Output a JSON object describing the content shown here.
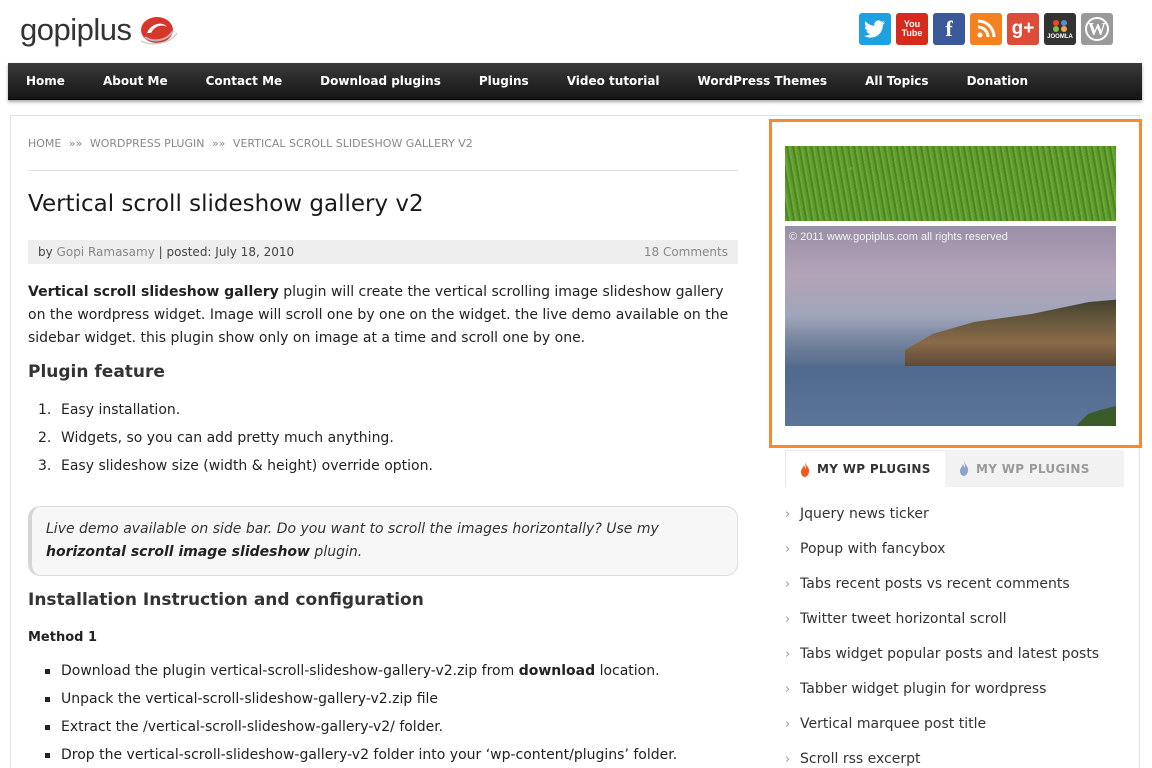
{
  "header": {
    "logo_text": "gopiplus",
    "social_icons": [
      "twitter-icon",
      "youtube-icon",
      "facebook-icon",
      "rss-icon",
      "google-plus-icon",
      "joomla-icon",
      "wordpress-icon"
    ],
    "social_labels": {
      "youtube": "You Tube",
      "facebook": "f",
      "google": "g+",
      "joomla": "JOOMLA",
      "wordpress": "W"
    }
  },
  "nav": {
    "items": [
      "Home",
      "About Me",
      "Contact Me",
      "Download plugins",
      "Plugins",
      "Video tutorial",
      "WordPress Themes",
      "All Topics",
      "Donation"
    ]
  },
  "breadcrumb": {
    "items": [
      "HOME",
      "WORDPRESS PLUGIN",
      "VERTICAL SCROLL SLIDESHOW GALLERY V2"
    ],
    "separator": "»»"
  },
  "post": {
    "title": "Vertical scroll slideshow gallery v2",
    "meta_by": "by",
    "author": "Gopi Ramasamy",
    "posted": "| posted: July 18, 2010",
    "comments": "18 Comments",
    "intro_bold": "Vertical scroll slideshow gallery",
    "intro_rest": " plugin will create the vertical scrolling image slideshow gallery on the wordpress widget. Image will scroll one by one on the widget. the live demo available on the sidebar widget. this plugin show only on image at a time and scroll one by one.",
    "feature_heading": "Plugin feature",
    "features": [
      "Easy installation.",
      "Widgets, so you can add pretty much anything.",
      "Easy slideshow size (width & height) override option."
    ],
    "quote_text": "Live demo available on side bar. Do you want to scroll the images horizontally? Use my",
    "quote_link": "horizontal scroll image slideshow",
    "quote_tail": " plugin.",
    "install_heading": "Installation Instruction and configuration",
    "method_label": "Method 1",
    "steps": [
      {
        "text": "Download the plugin vertical-scroll-slideshow-gallery-v2.zip from ",
        "bold": "download",
        "tail": " location."
      },
      {
        "text": "Unpack the vertical-scroll-slideshow-gallery-v2.zip file",
        "bold": "",
        "tail": ""
      },
      {
        "text": "Extract the /vertical-scroll-slideshow-gallery-v2/ folder.",
        "bold": "",
        "tail": ""
      },
      {
        "text": "Drop the vertical-scroll-slideshow-gallery-v2 folder into your ‘wp-content/plugins’ folder.",
        "bold": "",
        "tail": ""
      }
    ]
  },
  "sidebar": {
    "copyright": "© 2011 www.gopiplus.com all rights reserved",
    "tabs": [
      "MY WP PLUGINS",
      "MY WP PLUGINS"
    ],
    "plugins": [
      "Jquery news ticker",
      "Popup with fancybox",
      "Tabs recent posts vs recent comments",
      "Twitter tweet horizontal scroll",
      "Tabs widget popular posts and latest posts",
      "Tabber widget plugin for wordpress",
      "Vertical marquee post title",
      "Scroll rss excerpt"
    ]
  },
  "colors": {
    "accent_orange": "#f58a33",
    "nav_bg": "#222222",
    "twitter": "#1da1e0",
    "youtube": "#d52b1e",
    "facebook": "#3b5998",
    "rss": "#f58220",
    "google": "#dd4b39",
    "joomla": "#333333",
    "wordpress": "#9a9a9a"
  }
}
